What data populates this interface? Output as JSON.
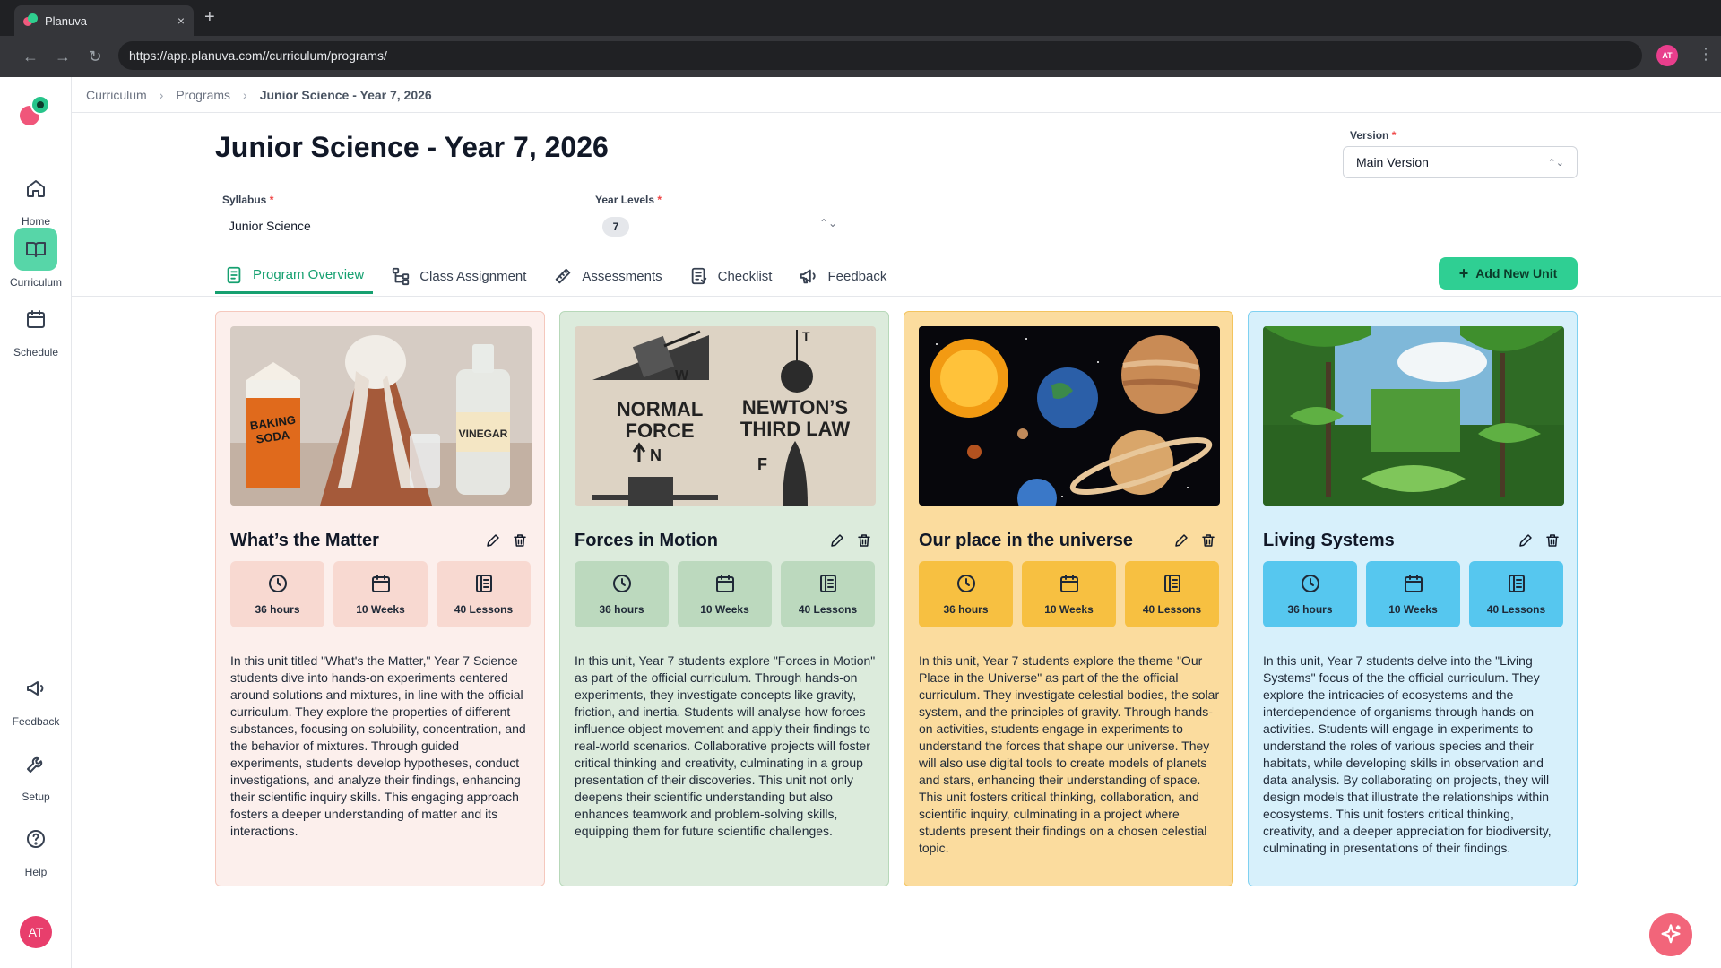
{
  "browser": {
    "tab_title": "Planuva",
    "tab_close": "×",
    "new_tab": "+",
    "url": "https://app.planuva.com//curriculum/programs/",
    "avatar": "AT"
  },
  "sidebar": {
    "items": [
      {
        "label": "Home",
        "icon": "home-icon"
      },
      {
        "label": "Curriculum",
        "icon": "book-icon"
      },
      {
        "label": "Schedule",
        "icon": "calendar-icon"
      },
      {
        "label": "Feedback",
        "icon": "megaphone-icon"
      },
      {
        "label": "Setup",
        "icon": "wrench-icon"
      },
      {
        "label": "Help",
        "icon": "help-icon"
      }
    ],
    "avatar": "AT"
  },
  "breadcrumb": {
    "items": [
      "Curriculum",
      "Programs",
      "Junior Science - Year 7, 2026"
    ]
  },
  "header": {
    "title": "Junior Science - Year 7, 2026",
    "syllabus_label": "Syllabus",
    "syllabus_value": "Junior Science",
    "year_levels_label": "Year Levels",
    "year_level_chip": "7",
    "version_label": "Version",
    "version_value": "Main Version",
    "required_mark": "*"
  },
  "tabs": [
    {
      "label": "Program Overview",
      "active": true
    },
    {
      "label": "Class Assignment",
      "active": false
    },
    {
      "label": "Assessments",
      "active": false
    },
    {
      "label": "Checklist",
      "active": false
    },
    {
      "label": "Feedback",
      "active": false
    }
  ],
  "add_unit_label": "Add New Unit",
  "units": [
    {
      "title": "What’s the Matter",
      "hours": "36 hours",
      "weeks": "10 Weeks",
      "lessons": "40 Lessons",
      "image_text": [
        "BAKING",
        "SODA",
        "VINEGAR"
      ],
      "description": "In this unit titled \"What's the Matter,\" Year 7 Science students dive into hands-on experiments centered around solutions and mixtures, in line with the official curriculum. They explore the properties of different substances, focusing on solubility, concentration, and the behavior of mixtures. Through guided experiments, students develop hypotheses, conduct investigations, and analyze their findings, enhancing their scientific inquiry skills. This engaging approach fosters a deeper understanding of matter and its interactions."
    },
    {
      "title": "Forces in Motion",
      "hours": "36 hours",
      "weeks": "10 Weeks",
      "lessons": "40 Lessons",
      "image_text": [
        "NORMAL",
        "FORCE",
        "NEWTON’S",
        "THIRD LAW",
        "W",
        "N",
        "F",
        "T"
      ],
      "description": "In this unit, Year 7 students explore \"Forces in Motion\" as part of the official curriculum. Through hands-on experiments, they investigate concepts like gravity, friction, and inertia. Students will analyse how forces influence object movement and apply their findings to real-world scenarios. Collaborative projects will foster critical thinking and creativity, culminating in a group presentation of their discoveries. This unit not only deepens their scientific understanding but also enhances teamwork and problem-solving skills, equipping them for future scientific challenges."
    },
    {
      "title": "Our place in the universe",
      "hours": "36 hours",
      "weeks": "10 Weeks",
      "lessons": "40 Lessons",
      "image_text": [],
      "description": "In this unit, Year 7 students explore the theme \"Our Place in the Universe\" as part of the the official curriculum. They investigate celestial bodies, the solar system, and the principles of gravity. Through hands-on activities, students engage in experiments to understand the forces that shape our universe. They will also use digital tools to create models of planets and stars, enhancing their understanding of space. This unit fosters critical thinking, collaboration, and scientific inquiry, culminating in a project where students present their findings on a chosen celestial topic."
    },
    {
      "title": "Living Systems",
      "hours": "36 hours",
      "weeks": "10 Weeks",
      "lessons": "40 Lessons",
      "image_text": [],
      "description": "In this unit, Year 7 students delve into the \"Living Systems\" focus of the the official curriculum. They explore the intricacies of ecosystems and the interdependence of organisms through hands-on activities. Students will engage in experiments to understand the roles of various species and their habitats, while developing skills in observation and data analysis. By collaborating on projects, they will design models that illustrate the relationships within ecosystems. This unit fosters critical thinking, creativity, and a deeper appreciation for biodiversity, culminating in presentations of their findings."
    }
  ]
}
